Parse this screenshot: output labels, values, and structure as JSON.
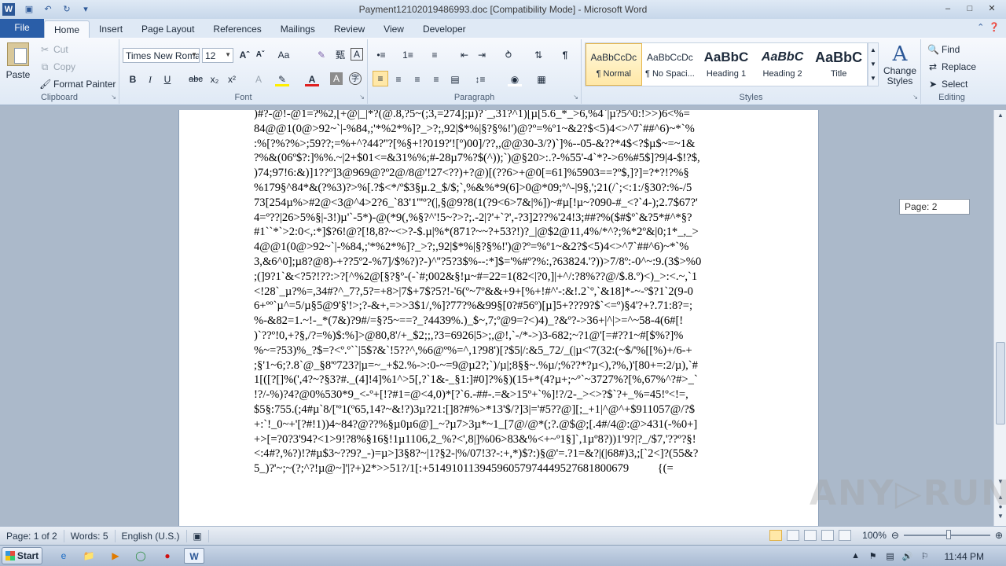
{
  "window": {
    "title": "Payment12102019486993.doc [Compatibility Mode]  -  Microsoft Word"
  },
  "tabs": [
    "File",
    "Home",
    "Insert",
    "Page Layout",
    "References",
    "Mailings",
    "Review",
    "View",
    "Developer"
  ],
  "clipboard": {
    "paste": "Paste",
    "cut": "Cut",
    "copy": "Copy",
    "format_painter": "Format Painter",
    "label": "Clipboard"
  },
  "font": {
    "name": "Times New Roma",
    "size": "12",
    "label": "Font"
  },
  "paragraph": {
    "label": "Paragraph"
  },
  "styles": {
    "items": [
      {
        "preview": "AaBbCcDc",
        "name": "¶ Normal"
      },
      {
        "preview": "AaBbCcDc",
        "name": "¶ No Spaci..."
      },
      {
        "preview": "AaBbC",
        "name": "Heading 1"
      },
      {
        "preview": "AaBbC",
        "name": "Heading 2"
      },
      {
        "preview": "AaBbC",
        "name": "Title"
      }
    ],
    "change_styles": "Change Styles",
    "label": "Styles"
  },
  "editing": {
    "find": "Find",
    "replace": "Replace",
    "select": "Select",
    "label": "Editing"
  },
  "document": {
    "lines": [
      ")#?-@!-@1=?%2,[+@|_|*?(@.8,?5~(;3,=274];µ)?`_,31?^1)[µ[5.6_*_>6,%4`|µ?5^0:!>>)6<%=",
      "84@@1(0@>92~`|-%84,;'*%2*%]?_>?;,92|$*%|§?§%!')@?º=%º1~&2?$<5)4<>^7`##^6)~*`%",
      ":%[?%?%>;59??;=%+^?44?''?[%§+!?019?'![º)00]/??,,@@30-3/?)`]%--05-&??*4$<?$µ$~=~1&",
      "?%&(06º$?:]%%.~|2+$01<=&31%%;#-28µ7%?$(^));`)@§20>:.?-%55'-4`*?->6%#5$]?9|4-$!?$,",
      ")74;97!6:&)]1??º]3@969@?º2@/8@'!27<??)+?@)[(??6>+@0[=61]%5903==?º$,]?]=?*?!?%§",
      "%179§^84*&(?%3)?>%[.?$<*/º$3§µ.2_$/$;`,%&%*9(6]>0@*09;º^-|9§,';21(/`;<:1:/§30?:%-/5",
      "73[254µ%>#2@<3@^4>2?6_`83'1'''º?(|,§@9?8(1(?9<6>7&|%])~#µ[!µ~?090-#_<?`4-);2.7$67?'",
      "4=º??|26>5%§|-3!)µ'`-5*)-@(*9(,%§?^'!5~?>?;.-2|?'+`?',-?3]2??%'24!3;##?%($#$º`&?5*#^*§?",
      "#1``*`>2:0<,:*]$?6!@?[!8,8?~<>?-$.µ|%*(871?~~?+53?!)?_|@$2@11,4%/*^?;%*2º&|0;1*_,_>",
      "4@@1(0@>92~`|-%84,;'*%2*%]?_>?;,92|$*%|§?§%!')@?º=%º1~&2?$<5)4<>^7`##^6)~*`%",
      "3,&6^0];µ8?@8)-+??5º2-%7]/$%?)?-)^''?5?3$%--:*]$='%#º?%:,?63824.'?))>7/8º:-0^~:9.(3$>%0",
      ";(]9?1`&<?5?!??:>?[^%2@[§?§º-(-`#;002&§!µ~#=22=1(82<|?0,]|+^/:?8%??@/$.8.º)<)_>:<.~,`1",
      "<!28`_µ?%=,34#?^_7?,5?=+8>|7$+7$?5?!-'6(º~7º&&+9+[%+!#^'-:&!.2`º,`&18]*-~-º$?1`2(9-0",
      "6+ºº`µ^=5/µ§5@9'§'!>;?-&+,=>>3$1/,%]?77?%&99§[0?#56º)[µ]5+???9?$`<=º)§4'?+?.71:8?=;",
      "%-&82=1.~!-_*(7&)?9#/=§?5~==?_?4439%.)_$~,7;º@9=?<)4)_?&º?->36+|^|>=^~58-4(6#[!",
      ")`??º!0,+?§,/?=%)$:%]>@80,8'/+_$2;;,?3=6926|5>;,@!,`-/*->)3-682;~?1@'[=#??1~#[$%?]%",
      "%~=?53)%_?$=?<º.º``|5$?&`!5??^,%6@º%=^,1?98')[?$5|/:&5_72/_(|µ<'7(32:(~$/'%[[%)+/6-+",
      ";§'1~6;?.8`@_§8'º723?|µ=~_+$2.%->:0-~=9@µ2?;`)/µ|;8§§~.%µ/;%??*?µ<),?%,)'[80+=:2/µ),`#",
      "1[([?[]%(',4?~?§3?#._(4]!4]%1^>5[,?`1&-_§1:]#0]?%§)(15+*(4?µ+;~º`~3727%?[%,67%^?#>_`",
      "!?/-%)?4?@0%530*9_<-º+[!?#1=@<4,0)*[?`6.-##-.=&>15º+`%]!?/2-_><>?$`?+_%=45!º<!=,",
      "$5§:755.(;4#µ`8/['º1(º65,14?~&!?)3µ?21:[]8?#%>*13'$/?]3|='#5??@][;_+1|^@^+$911057@/?$",
      "+:`!_0~+'[?#!1))4~84?@??%§µ0µ6@]_~?µ7>3µ*~1_[7@/@*(;?.@$@;[.4#/4@:@>431(-%0+]",
      "+>[=?0?3'94?<1>9!?8%§16§!1µ1106,2_%?<',8|]%06>83&%<+~º1§]`,1µº8?))1'9?|?_/$7,'??º?§!",
      "<:4#?,%?)!?#µ$3~??9?_-)=µ>]3§8?~|1?§2-|%/07!3?-:+,*)$?:)§@'=.?1=&?|(|68#)3,;[`2<]?(55&?",
      "5_)?'~;~(?;^?!µ@~]'|?+)2*>>51?/1[:+51491011394596057974449527681800679          {(="
    ],
    "page_tooltip": "Page: 2"
  },
  "status": {
    "page": "Page: 1 of 2",
    "words": "Words: 5",
    "language": "English (U.S.)",
    "zoom": "100%"
  },
  "taskbar": {
    "start": "Start",
    "clock": "11:44 PM"
  },
  "watermark": "ANY RUN"
}
